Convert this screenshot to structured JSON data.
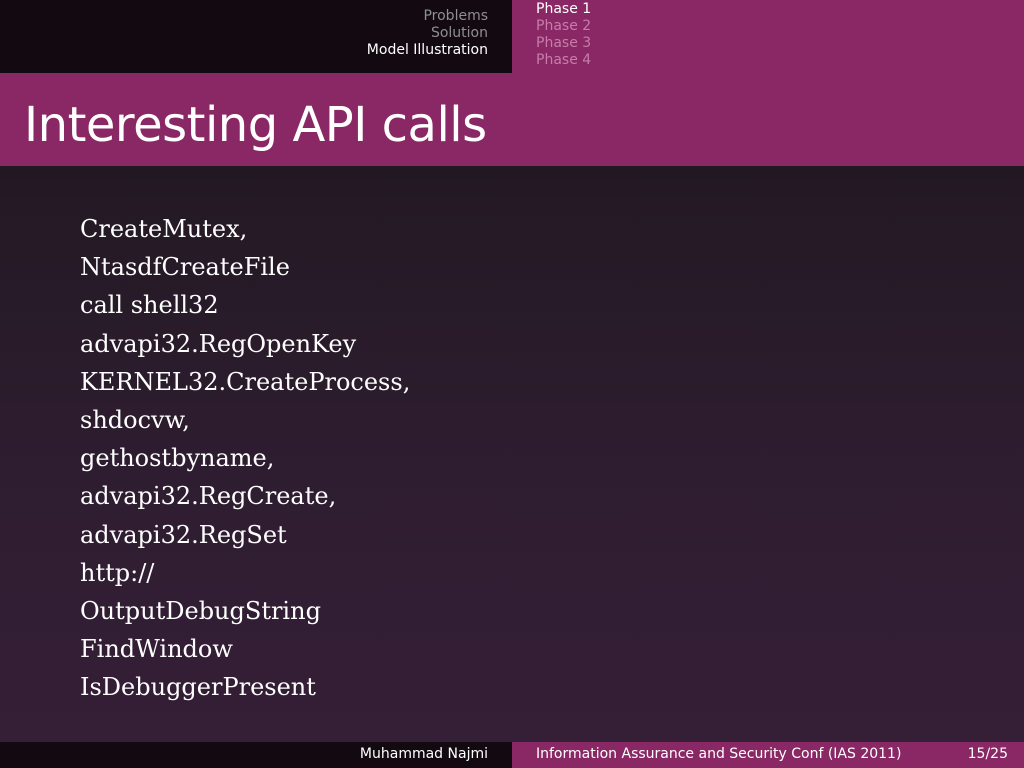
{
  "nav": {
    "sections": [
      "Problems",
      "Solution",
      "Model Illustration"
    ],
    "active_section": "Model Illustration",
    "subsections": [
      "Phase 1",
      "Phase 2",
      "Phase 3",
      "Phase 4"
    ],
    "active_subsection": "Phase 1"
  },
  "slide": {
    "title": "Interesting API calls",
    "lines": [
      "CreateMutex,",
      "NtasdfCreateFile",
      "call shell32",
      "advapi32.RegOpenKey",
      "KERNEL32.CreateProcess,",
      "shdocvw,",
      "gethostbyname,",
      "advapi32.RegCreate,",
      "advapi32.RegSet",
      "http://",
      "OutputDebugString",
      "FindWindow",
      "IsDebuggerPresent"
    ]
  },
  "footer": {
    "author": "Muhammad Najmi",
    "conference": "Information Assurance and Security Conf (IAS 2011)",
    "page": "15/25"
  },
  "colors": {
    "accent": "#8a2865",
    "dark_bar": "#120a10",
    "background": "#2f1d31"
  }
}
